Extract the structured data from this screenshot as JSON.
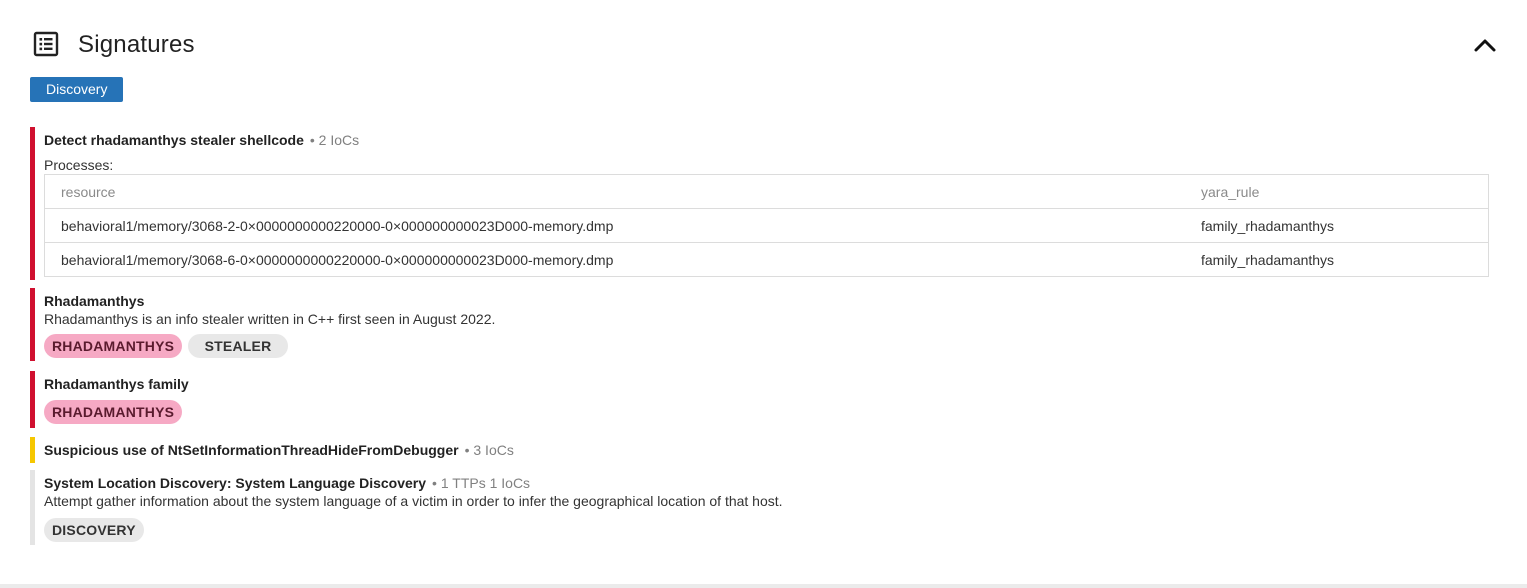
{
  "header": {
    "title": "Signatures",
    "icon": "list-icon",
    "collapse_icon": "chevron-up-icon"
  },
  "filter": {
    "label": "Discovery",
    "color": "#2673b7"
  },
  "signatures": [
    {
      "title": "Detect rhadamanthys stealer shellcode",
      "meta": "• 2 IoCs",
      "severity_color": "#d0102f",
      "processes_label": "Processes:",
      "table": {
        "headers": [
          "resource",
          "yara_rule"
        ],
        "rows": [
          [
            "behavioral1/memory/3068-2-0×0000000000220000-0×000000000023D000-memory.dmp",
            "family_rhadamanthys"
          ],
          [
            "behavioral1/memory/3068-6-0×0000000000220000-0×000000000023D000-memory.dmp",
            "family_rhadamanthys"
          ]
        ]
      }
    },
    {
      "title": "Rhadamanthys",
      "description": "Rhadamanthys is an info stealer written in C++ first seen in August 2022.",
      "severity_color": "#d0102f",
      "tags": [
        "RHADAMANTHYS",
        "STEALER"
      ]
    },
    {
      "title": "Rhadamanthys family",
      "severity_color": "#d0102f",
      "tags": [
        "RHADAMANTHYS"
      ]
    },
    {
      "title": "Suspicious use of NtSetInformationThreadHideFromDebugger",
      "meta": "• 3 IoCs",
      "severity_color": "#f6c700"
    },
    {
      "title": "System Location Discovery: System Language Discovery",
      "meta": "• 1 TTPs 1 IoCs",
      "description": "Attempt gather information about the system language of a victim in order to infer the geographical location of that host.",
      "severity_color": "#e4e4e4",
      "tags": [
        "DISCOVERY"
      ]
    }
  ]
}
